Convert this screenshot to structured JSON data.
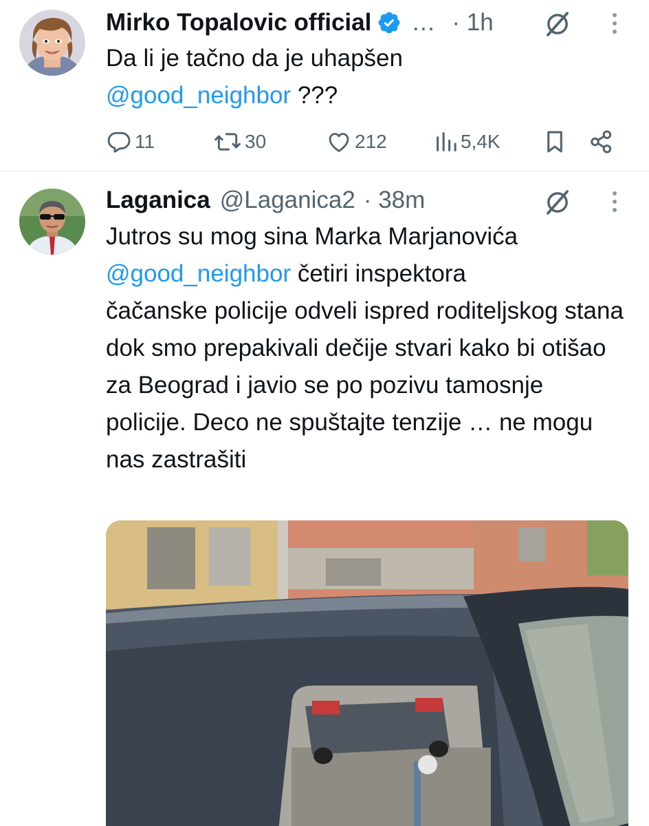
{
  "tweet1": {
    "author_name": "Mirko Topalovic official",
    "ellipsis": "…",
    "time": "· 1h",
    "body": "Da li je tačno da je uhapšen",
    "mention": "@good_neighbor",
    "body_after_mention": " ???",
    "replies": "11",
    "reposts": "30",
    "likes": "212",
    "views": "5,4K"
  },
  "tweet2": {
    "author_name": "Laganica",
    "handle": "@Laganica2",
    "time": "· 38m",
    "line1": "Jutros su mog sina Marka Marjanovića",
    "mention": "@good_neighbor",
    "line2_after_mention": " četiri inspektora",
    "rest": "čačanske policije odveli ispred roditeljskog stana dok smo prepakivali dečije stvari kako bi otišao za Beograd i javio se po pozivu tamosnje policije. Deco ne spuštajte tenzije … ne mogu nas zastrašiti"
  },
  "colors": {
    "accent": "#1d9bf0",
    "secondary_text": "#536471",
    "divider": "#e6e9ec"
  },
  "icons": {
    "verified": "verified-badge-icon",
    "grok": "grok-icon",
    "more": "more-vertical-icon",
    "reply": "reply-icon",
    "repost": "repost-icon",
    "like": "heart-icon",
    "views": "views-icon",
    "bookmark": "bookmark-icon",
    "share": "share-icon"
  }
}
